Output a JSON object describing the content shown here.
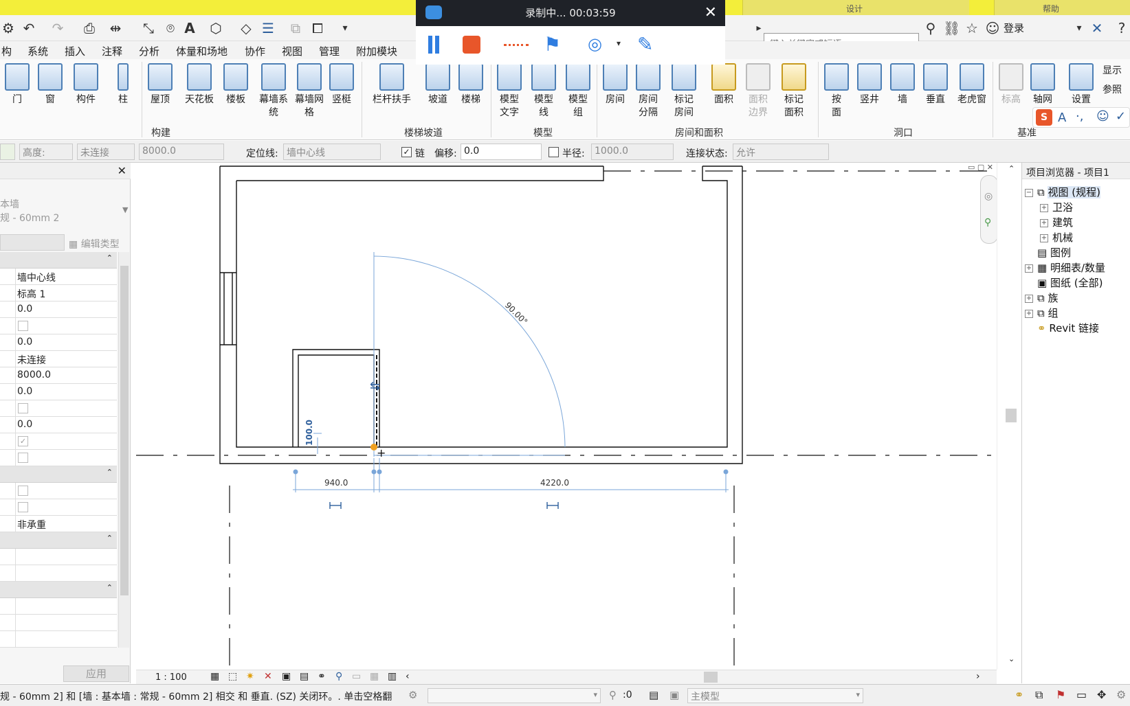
{
  "app": {
    "colors": {
      "title_bar": "#f3ee3a",
      "accent": "#4d7fb5",
      "dim_line": "#7aa6d9",
      "recorder_dark": "#1f2228",
      "recorder_stop": "#e8562a"
    }
  },
  "titlebar": {
    "tab_right_1": "设计",
    "tab_right_2": "帮助"
  },
  "recorder": {
    "status": "录制中... 00:03:59",
    "icons": [
      "camera-icon",
      "pause-icon",
      "stop-icon",
      "dash-icon",
      "cursor-flag-icon",
      "webcam-icon",
      "pen-icon",
      "close-icon"
    ]
  },
  "search": {
    "placeholder": "键入关键字或短语",
    "login_label": "登录"
  },
  "menu": [
    "构",
    "系统",
    "插入",
    "注释",
    "分析",
    "体量和场地",
    "协作",
    "视图",
    "管理",
    "附加模块"
  ],
  "ribbon": {
    "buttons": [
      {
        "label": "门",
        "name": "door"
      },
      {
        "label": "窗",
        "name": "window"
      },
      {
        "label": "构件",
        "name": "component"
      },
      {
        "label": "柱",
        "name": "column"
      },
      {
        "label": "屋顶",
        "name": "roof"
      },
      {
        "label": "天花板",
        "name": "ceiling"
      },
      {
        "label": "楼板",
        "name": "floor"
      },
      {
        "label": "幕墙系统",
        "name": "curtain-system"
      },
      {
        "label": "幕墙网格",
        "name": "curtain-grid"
      },
      {
        "label": "竖梃",
        "name": "mullion"
      },
      {
        "label": "栏杆扶手",
        "name": "railing"
      },
      {
        "label": "坡道",
        "name": "ramp"
      },
      {
        "label": "楼梯",
        "name": "stair"
      },
      {
        "label": "模型文字",
        "name": "model-text"
      },
      {
        "label": "模型线",
        "name": "model-line"
      },
      {
        "label": "模型组",
        "name": "model-group"
      },
      {
        "label": "房间",
        "name": "room"
      },
      {
        "label": "房间分隔",
        "name": "room-separator"
      },
      {
        "label": "标记房间",
        "name": "tag-room"
      },
      {
        "label": "面积",
        "name": "area"
      },
      {
        "label": "面积边界",
        "name": "area-boundary",
        "disabled": true
      },
      {
        "label": "标记面积",
        "name": "tag-area"
      },
      {
        "label": "按面",
        "name": "by-face"
      },
      {
        "label": "竖井",
        "name": "shaft"
      },
      {
        "label": "墙",
        "name": "wall-opening"
      },
      {
        "label": "垂直",
        "name": "vertical"
      },
      {
        "label": "老虎窗",
        "name": "dormer"
      },
      {
        "label": "标高",
        "name": "level",
        "disabled": true
      },
      {
        "label": "轴网",
        "name": "grid"
      },
      {
        "label": "设置",
        "name": "set"
      },
      {
        "label": "显示",
        "name": "show"
      },
      {
        "label": "参照",
        "name": "ref-plane"
      }
    ],
    "groups": [
      "构建",
      "楼梯坡道",
      "模型",
      "房间和面积",
      "洞口",
      "基准"
    ]
  },
  "options": {
    "height_label": "高度:",
    "height_value": "未连接",
    "height_number": "8000.0",
    "location_label": "定位线:",
    "location_value": "墙中心线",
    "chain_label": "链",
    "offset_label": "偏移:",
    "offset_value": "0.0",
    "radius_label": "半径:",
    "radius_value": "1000.0",
    "join_label": "连接状态:",
    "join_value": "允许"
  },
  "properties": {
    "type_line1": "本墙",
    "type_line2": "规 - 60mm 2",
    "edit_type": "编辑类型",
    "rows": [
      "墙中心线",
      "标高 1",
      "0.0",
      "",
      "0.0",
      "未连接",
      "8000.0",
      "0.0",
      "",
      "0.0",
      "",
      ""
    ],
    "row_after": "非承重",
    "apply": "应用"
  },
  "drawing": {
    "angle_label": "90.00°",
    "dim_left": "940.0",
    "dim_right": "4220.0",
    "dim_vertical": "100.0"
  },
  "browser": {
    "title": "项目浏览器 - 项目1",
    "items": [
      "视图 (规程)",
      "卫浴",
      "建筑",
      "机械",
      "图例",
      "明细表/数量",
      "图纸 (全部)",
      "族",
      "组",
      "Revit 链接"
    ]
  },
  "viewctl": {
    "scale": "1 : 100"
  },
  "status": {
    "message": "规 - 60mm 2] 和 [墙 : 基本墙 : 常规 - 60mm 2] 相交 和 垂直. (SZ) 关闭环。. 单击空格翻",
    "sel_count": ":0",
    "model": "主模型"
  }
}
